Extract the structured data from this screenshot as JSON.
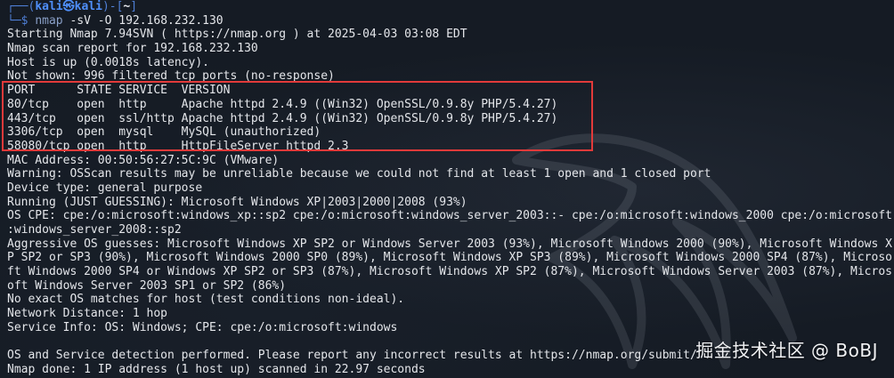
{
  "prompt": {
    "corner": "┌──(",
    "user": "kali㉿kali",
    "close_open": ")-[",
    "dir": "~",
    "close": "]",
    "dollar_prefix": "└─$ ",
    "tool": "nmap",
    "args": " -sV -O 192.168.232.130"
  },
  "output_lines": [
    "Starting Nmap 7.94SVN ( https://nmap.org ) at 2025-04-03 03:08 EDT",
    "Nmap scan report for 192.168.232.130",
    "Host is up (0.0018s latency).",
    "Not shown: 996 filtered tcp ports (no-response)",
    "PORT      STATE SERVICE  VERSION",
    "80/tcp    open  http     Apache httpd 2.4.9 ((Win32) OpenSSL/0.9.8y PHP/5.4.27)",
    "443/tcp   open  ssl/http Apache httpd 2.4.9 ((Win32) OpenSSL/0.9.8y PHP/5.4.27)",
    "3306/tcp  open  mysql    MySQL (unauthorized)",
    "58080/tcp open  http     HttpFileServer httpd 2.3",
    "MAC Address: 00:50:56:27:5C:9C (VMware)",
    "Warning: OSScan results may be unreliable because we could not find at least 1 open and 1 closed port",
    "Device type: general purpose",
    "Running (JUST GUESSING): Microsoft Windows XP|2003|2000|2008 (93%)",
    "OS CPE: cpe:/o:microsoft:windows_xp::sp2 cpe:/o:microsoft:windows_server_2003::- cpe:/o:microsoft:windows_2000 cpe:/o:microsoft",
    ":windows_server_2008::sp2",
    "Aggressive OS guesses: Microsoft Windows XP SP2 or Windows Server 2003 (93%), Microsoft Windows 2000 (90%), Microsoft Windows X",
    "P SP2 or SP3 (90%), Microsoft Windows 2000 SP0 (89%), Microsoft Windows XP SP3 (89%), Microsoft Windows 2000 SP4 (87%), Microso",
    "ft Windows 2000 SP4 or Windows XP SP2 or SP3 (87%), Microsoft Windows XP SP2 (87%), Microsoft Windows Server 2003 (87%), Micros",
    "oft Windows Server 2003 SP1 or SP2 (86%)",
    "No exact OS matches for host (test conditions non-ideal).",
    "Network Distance: 1 hop",
    "Service Info: OS: Windows; CPE: cpe:/o:microsoft:windows",
    "",
    "OS and Service detection performed. Please report any incorrect results at https://nmap.org/submit/ .",
    "Nmap done: 1 IP address (1 host up) scanned in 22.97 seconds"
  ],
  "watermark": "掘金技术社区 @ BoBJ",
  "colors": {
    "background": "#151b24",
    "text": "#e4e6ea",
    "prompt_blue": "#4f8ffa",
    "highlight_red": "#e23a3a"
  }
}
